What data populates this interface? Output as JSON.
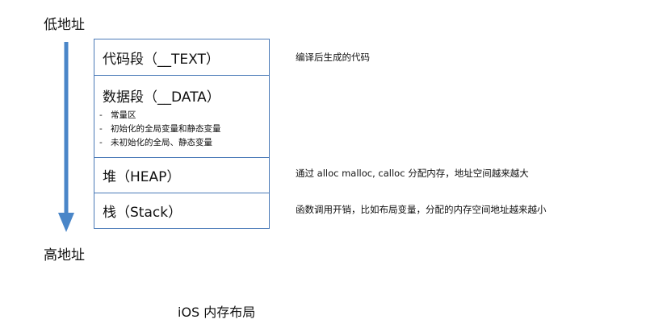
{
  "labels": {
    "low_address": "低地址",
    "high_address": "高地址",
    "caption": "iOS  内存布局"
  },
  "colors": {
    "arrow": "#4a86c8",
    "border": "#4a7ab8"
  },
  "segments": [
    {
      "title": "代码段（__TEXT）",
      "description": "编译后生成的代码"
    },
    {
      "title": "数据段（__DATA）",
      "items": [
        "常量区",
        "初始化的全局变量和静态变量",
        "未初始化的全局、静态变量"
      ],
      "description": ""
    },
    {
      "title": "堆（HEAP）",
      "description": "通过 alloc malloc, calloc 分配内存，地址空间越来越大"
    },
    {
      "title": "栈（Stack）",
      "description": "函数调用开销，比如布局变量，分配的内存空间地址越来越小"
    }
  ]
}
